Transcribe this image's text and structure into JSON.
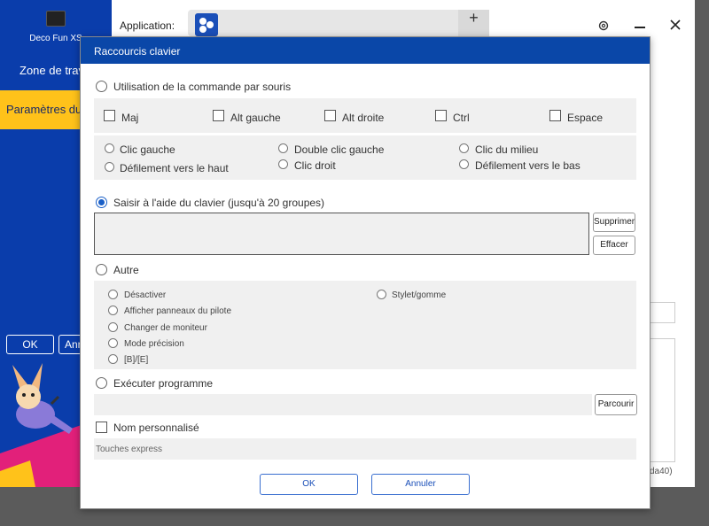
{
  "background_app": {
    "device_name": "Deco Fun XS",
    "sidebar_workspace": "Zone de trav",
    "sidebar_params": "Paramètres du",
    "ok_label": "OK",
    "cancel_label": "Ann",
    "application_label": "Application:",
    "add_label": "+",
    "footer_text": "da40)"
  },
  "dialog": {
    "title": "Raccourcis clavier",
    "mouse_command": {
      "label": "Utilisation de la commande par souris",
      "selected": false,
      "modifiers": [
        "Maj",
        "Alt gauche",
        "Alt droite",
        "Ctrl",
        "Espace"
      ],
      "clicks": [
        "Clic gauche",
        "Double clic gauche",
        "Clic du milieu",
        "Défilement vers le haut",
        "Clic droit",
        "Défilement vers le bas"
      ]
    },
    "keyboard": {
      "label": "Saisir à l'aide du clavier (jusqu'à 20 groupes)",
      "selected": true,
      "value": "",
      "delete_label": "Supprimer",
      "clear_label": "Effacer"
    },
    "other": {
      "label": "Autre",
      "selected": false,
      "options": [
        "Désactiver",
        "Afficher panneaux du pilote",
        "Changer de moniteur",
        "Mode précision",
        "[B]/[E]",
        "Stylet/gomme"
      ]
    },
    "run_program": {
      "label": "Exécuter programme",
      "selected": false,
      "path": "",
      "browse_label": "Parcourir"
    },
    "custom_name": {
      "label": "Nom personnalisé",
      "checked": false,
      "field_label": "Touches express"
    },
    "ok_label": "OK",
    "cancel_label": "Annuler"
  },
  "colors": {
    "dialog_header": "#0a47a8",
    "sidebar_bg": "#0a3dab",
    "sidebar_active": "#ffc21a",
    "accent": "#1a5fc7"
  }
}
